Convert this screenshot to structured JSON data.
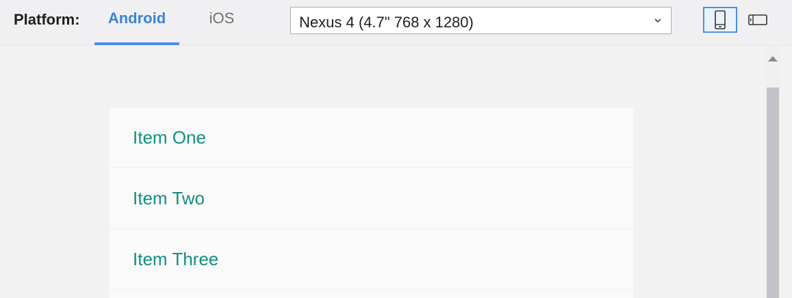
{
  "toolbar": {
    "platform_label": "Platform:",
    "tabs": [
      {
        "label": "Android",
        "selected": true
      },
      {
        "label": "iOS",
        "selected": false
      }
    ],
    "device_select": {
      "value": "Nexus 4 (4.7\" 768 x 1280)"
    },
    "orientation": {
      "portrait_icon": "phone-portrait-icon",
      "landscape_icon": "phone-landscape-icon",
      "selected": "portrait"
    }
  },
  "list": {
    "items": [
      {
        "label": "Item One"
      },
      {
        "label": "Item Two"
      },
      {
        "label": "Item Three"
      }
    ]
  },
  "colors": {
    "accent": "#4a8fe0",
    "item_text": "#128f80",
    "card_bg": "#fafafa",
    "page_bg": "#f2f2f2"
  }
}
